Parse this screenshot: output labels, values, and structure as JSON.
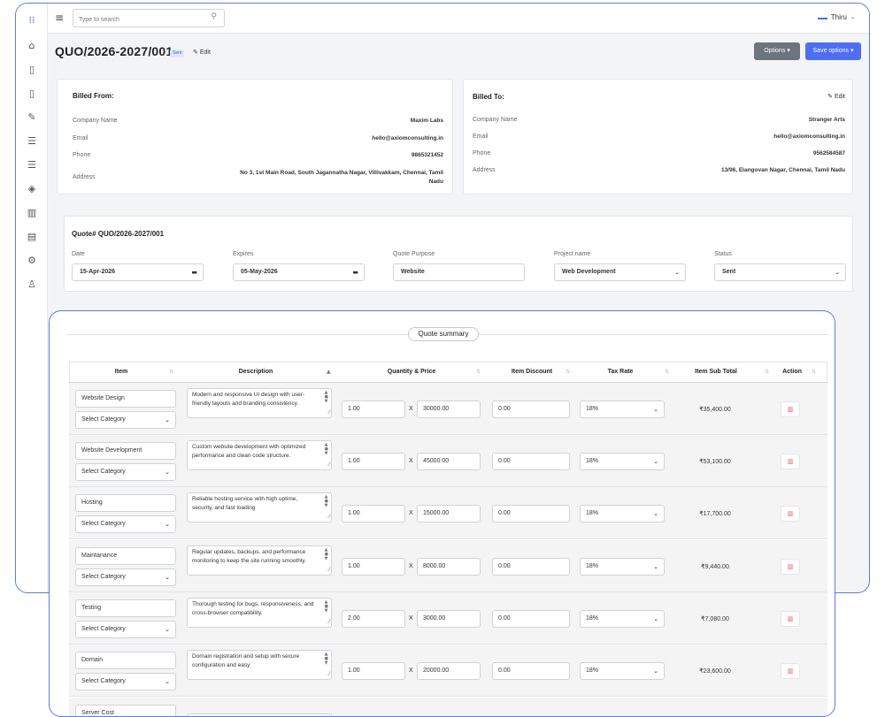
{
  "topbar": {
    "search_placeholder": "Type to search",
    "user_name": "Thiru"
  },
  "sidebar": {
    "icons": [
      "apps-icon",
      "home-icon",
      "document-icon",
      "document-icon",
      "edit-note-icon",
      "list-icon",
      "list-icon",
      "box-icon",
      "chart-icon",
      "file-icon",
      "settings-icon",
      "user-icon"
    ]
  },
  "header": {
    "title": "QUO/2026-2027/001",
    "status_badge": "Sent",
    "edit_label": "Edit",
    "options_label": "Options",
    "save_label": "Save options"
  },
  "billed_from": {
    "title": "Billed From:",
    "rows": [
      {
        "label": "Company Name",
        "value": "Maxim Labs"
      },
      {
        "label": "Email",
        "value": "hello@axiomconsulting.in"
      },
      {
        "label": "Phone",
        "value": "9865321452"
      },
      {
        "label": "Address",
        "value": "No 3, 1st Main Road, South Jagannatha Nagar, Villivakkam, Chennai, Tamil Nadu"
      }
    ]
  },
  "billed_to": {
    "title": "Billed To:",
    "edit_label": "Edit",
    "rows": [
      {
        "label": "Company Name",
        "value": "Stranger Arts"
      },
      {
        "label": "Email",
        "value": "hello@axiomconsulting.in"
      },
      {
        "label": "Phone",
        "value": "9562584587"
      },
      {
        "label": "Address",
        "value": "13/96, Elangovan Nagar, Chennai, Tamil Nadu"
      }
    ]
  },
  "quote": {
    "title": "Quote# QUO/2026-2027/001",
    "fields": [
      {
        "label": "Date",
        "value": "15-Apr-2026"
      },
      {
        "label": "Expires",
        "value": "05-May-2026"
      },
      {
        "label": "Quote Purpose",
        "value": "Website"
      },
      {
        "label": "Project name",
        "value": "Web Development"
      },
      {
        "label": "Status",
        "value": "Sent"
      }
    ]
  },
  "summary": {
    "title": "Quote summary",
    "columns": [
      "Item",
      "Description",
      "Quantity & Price",
      "Item Discount",
      "Tax Rate",
      "Item Sub Total",
      "Action"
    ],
    "category_placeholder": "Select Category",
    "times": "X",
    "rows": [
      {
        "item": "Website Design",
        "description": "Modern and responsive UI design with user-friendly layouts and branding consistency.",
        "qty": "1.00",
        "price": "30000.00",
        "discount": "0.00",
        "tax": "18%",
        "subtotal": "₹35,400.00"
      },
      {
        "item": "Website Development",
        "description": "Custom website development with optimized performance and clean code structure.",
        "qty": "1.00",
        "price": "45000.00",
        "discount": "0.00",
        "tax": "18%",
        "subtotal": "₹53,100.00"
      },
      {
        "item": "Hosting",
        "description": "Reliable hosting service with high uptime, security, and fast loading",
        "qty": "1.00",
        "price": "15000.00",
        "discount": "0.00",
        "tax": "18%",
        "subtotal": "₹17,700.00"
      },
      {
        "item": "Maintanance",
        "description": "Regular updates, backups, and performance monitoring to keep the site running smoothly.",
        "qty": "1.00",
        "price": "8000.00",
        "discount": "0.00",
        "tax": "18%",
        "subtotal": "₹9,440.00"
      },
      {
        "item": "Testing",
        "description": "Thorough testing for bugs, responsiveness, and cross-browser compatibility.",
        "qty": "2.00",
        "price": "3000.00",
        "discount": "0.00",
        "tax": "18%",
        "subtotal": "₹7,080.00"
      },
      {
        "item": "Domain",
        "description": "Domain registration and setup with secure configuration and easy",
        "qty": "1.00",
        "price": "20000.00",
        "discount": "0.00",
        "tax": "18%",
        "subtotal": "₹23,600.00"
      },
      {
        "item": "Server Cost",
        "description": "",
        "qty": "",
        "price": "",
        "discount": "",
        "tax": "",
        "subtotal": ""
      }
    ]
  }
}
